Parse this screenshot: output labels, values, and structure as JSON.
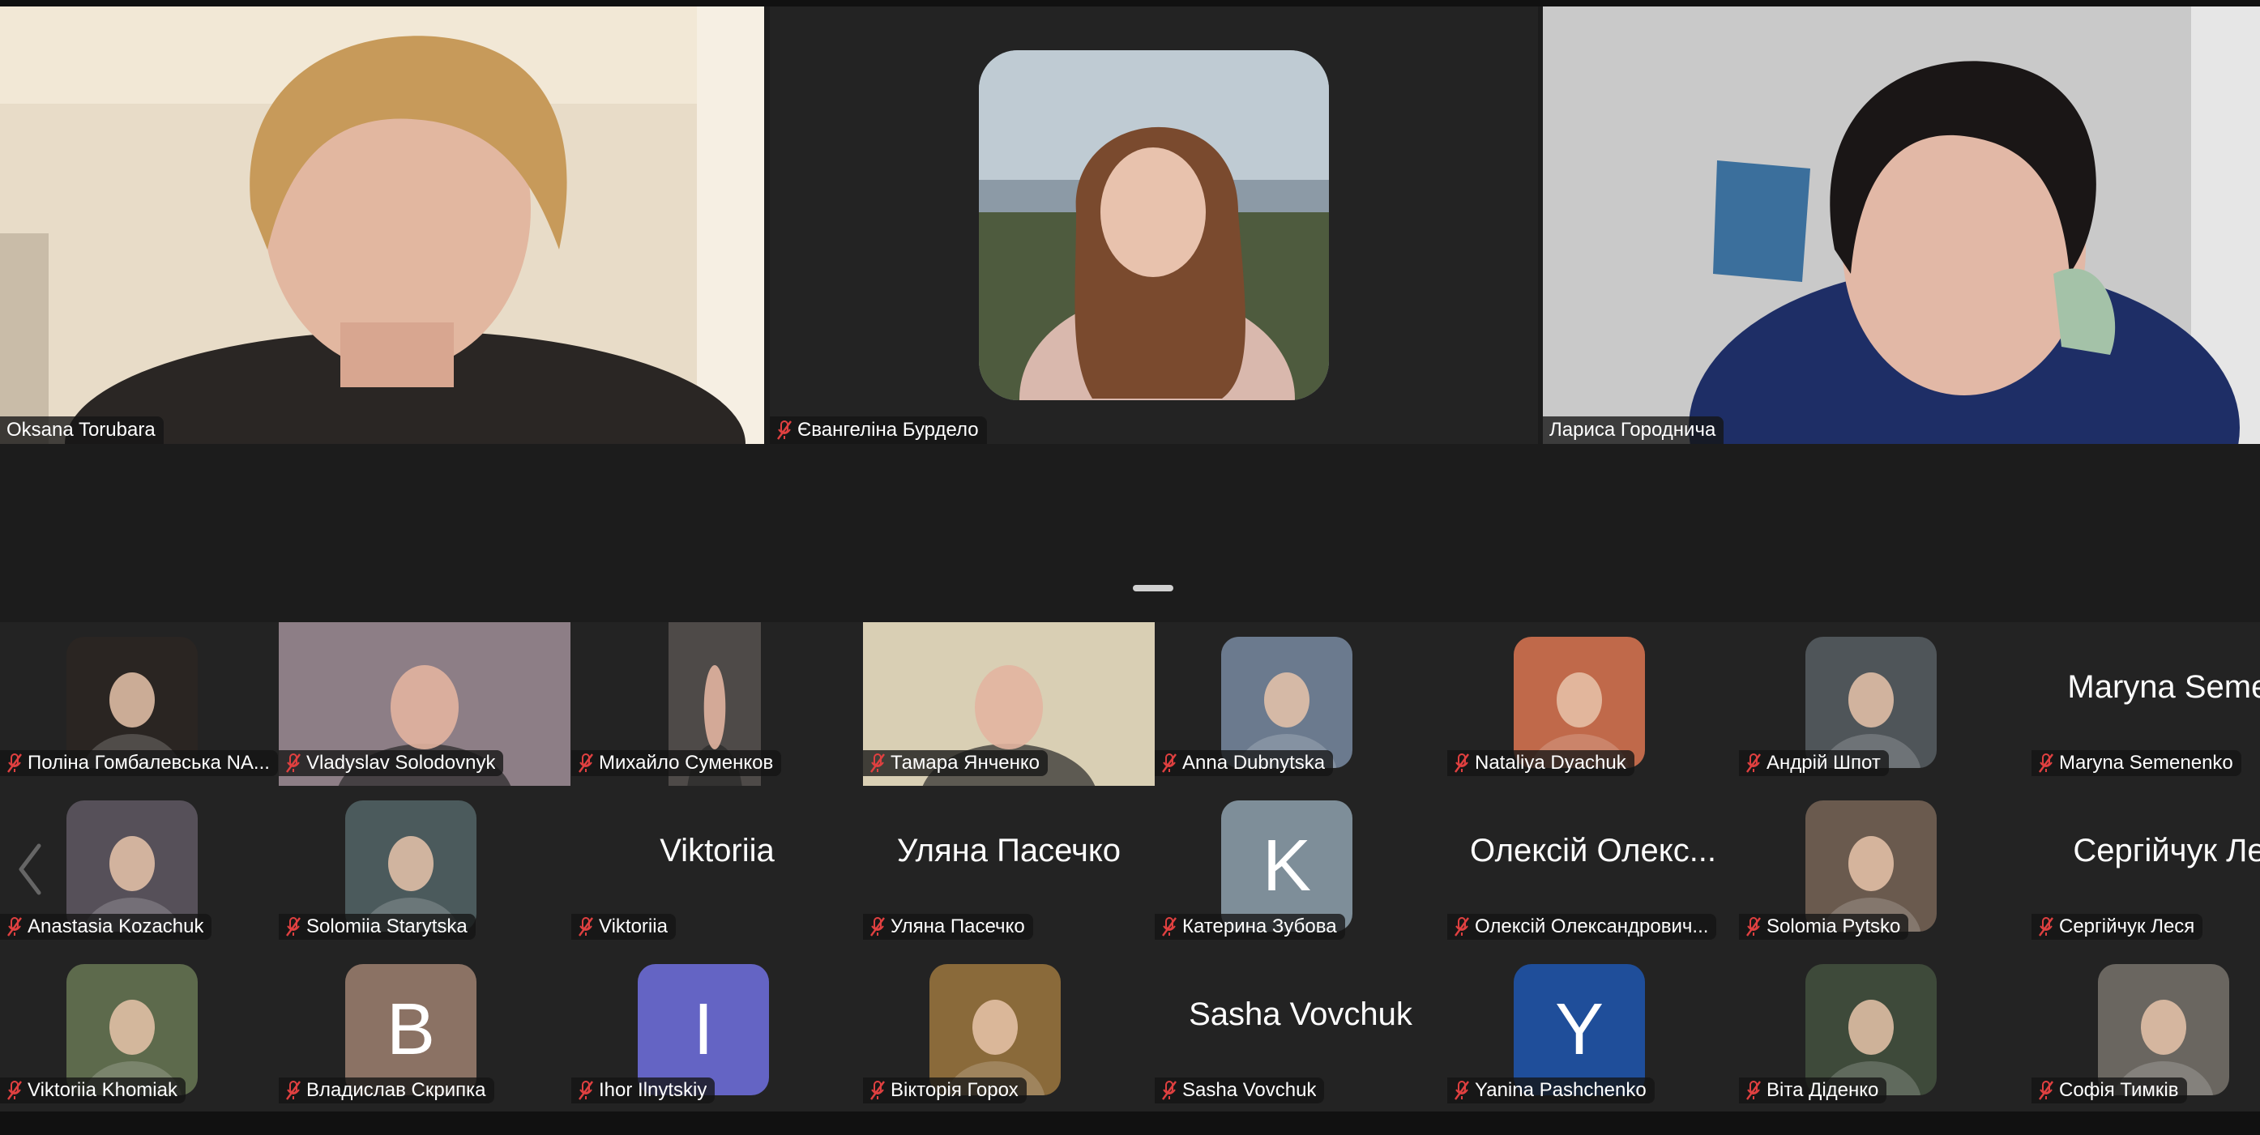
{
  "speakers": [
    {
      "name": "Oksana Torubara",
      "muted": false,
      "active": true
    },
    {
      "name": "Євангеліна Бурдело",
      "muted": true,
      "active": false
    },
    {
      "name": "Лариса Городнича",
      "muted": false,
      "active": false
    }
  ],
  "gallery": {
    "rows": [
      [
        {
          "name": "Поліна Гомбалевська NA...",
          "kind": "photo",
          "color": "#2a2522"
        },
        {
          "name": "Vladyslav Solodovnyk",
          "kind": "video",
          "color": "#8d7e86"
        },
        {
          "name": "Михайло Суменков",
          "kind": "video-narrow",
          "color": "#4e4a48"
        },
        {
          "name": "Тамара Янченко",
          "kind": "video",
          "color": "#d9cfb4"
        },
        {
          "name": "Anna Dubnytska",
          "kind": "photo",
          "color": "#6b7a8e"
        },
        {
          "name": "Nataliya Dyachuk",
          "kind": "photo",
          "color": "#c0694a"
        },
        {
          "name": "Андрій Шпот",
          "kind": "photo",
          "color": "#4f5559"
        },
        {
          "name": "Maryna Semenenko",
          "kind": "text",
          "big": "Maryna Semen"
        }
      ],
      [
        {
          "name": "Anastasia Kozachuk",
          "kind": "photo",
          "color": "#565059"
        },
        {
          "name": "Solomiia Starytska",
          "kind": "photo",
          "color": "#4b5a5c"
        },
        {
          "name": "Viktoriia",
          "kind": "text",
          "big": "Viktoriia"
        },
        {
          "name": "Уляна Пасечко",
          "kind": "text",
          "big": "Уляна Пасечко"
        },
        {
          "name": "Катерина Зубова",
          "kind": "letter",
          "letter": "K",
          "color": "#7e8e99"
        },
        {
          "name": "Олексій Олександрович...",
          "kind": "text",
          "big": "Олексій Олекс..."
        },
        {
          "name": "Solomia Pytsko",
          "kind": "photo",
          "color": "#6a5a4e"
        },
        {
          "name": "Сергійчук Леся",
          "kind": "text",
          "big": "Сергійчук Лес"
        }
      ],
      [
        {
          "name": "Viktoriia Khomiak",
          "kind": "photo",
          "color": "#5d6a4c"
        },
        {
          "name": "Владислав Скрипка",
          "kind": "letter",
          "letter": "B",
          "color": "#8b7264"
        },
        {
          "name": "Ihor Ilnytskiy",
          "kind": "letter",
          "letter": "I",
          "color": "#6464c4"
        },
        {
          "name": "Вікторія Горох",
          "kind": "photo",
          "color": "#8a6a3a"
        },
        {
          "name": "Sasha Vovchuk",
          "kind": "text",
          "big": "Sasha Vovchuk"
        },
        {
          "name": "Yanina Pashchenko",
          "kind": "letter",
          "letter": "Y",
          "color": "#1f4e9a"
        },
        {
          "name": "Віта Діденко",
          "kind": "photo",
          "color": "#3e4a3a"
        },
        {
          "name": "Софія Тимків",
          "kind": "photo",
          "color": "#6a6660"
        }
      ]
    ]
  },
  "icons": {
    "muted": "muted-mic-icon",
    "prev": "chevron-left-icon"
  }
}
